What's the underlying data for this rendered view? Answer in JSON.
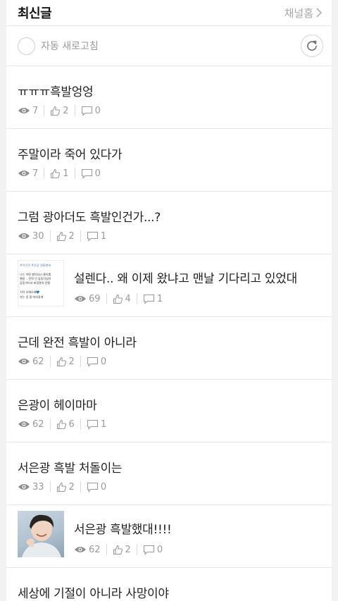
{
  "header": {
    "title": "최신글",
    "home_link": "채널홈"
  },
  "refresh": {
    "label": "자동 새로고침"
  },
  "posts": [
    {
      "title": "ㅠㅠㅠ흑발엉엉",
      "views": "7",
      "likes": "2",
      "comments": "0"
    },
    {
      "title": "주말이라 죽어 있다가",
      "views": "7",
      "likes": "1",
      "comments": "0"
    },
    {
      "title": "그럼 광아더도 흑발인건가...?",
      "views": "30",
      "likes": "2",
      "comments": "1"
    },
    {
      "title": "설렌다.. 왜 이제 왔냐고 맨날 기다리고 있었대",
      "views": "69",
      "likes": "4",
      "comments": "1",
      "thumb_text": [
        "#이민혁 #은광 영통팬싸",
        "나는 어떤 팬이냐고 물어봤",
        "행방 .. 민혁 넌 감동이었어",
        "감동이어서 표정관리 안됐",
        "기차 오래오래💙",
        "가는 길 잘 따라갈게"
      ]
    },
    {
      "title": "근데 완전 흑발이 아니라",
      "views": "62",
      "likes": "2",
      "comments": "0"
    },
    {
      "title": "은광이 헤이마마",
      "views": "62",
      "likes": "6",
      "comments": "1"
    },
    {
      "title": "서은광 흑발 처돌이는",
      "views": "33",
      "likes": "2",
      "comments": "0"
    },
    {
      "title": "서은광 흑발했대!!!!",
      "views": "62",
      "likes": "2",
      "comments": "0"
    },
    {
      "title": "세상에 기절이 아니라 사망이야"
    }
  ]
}
